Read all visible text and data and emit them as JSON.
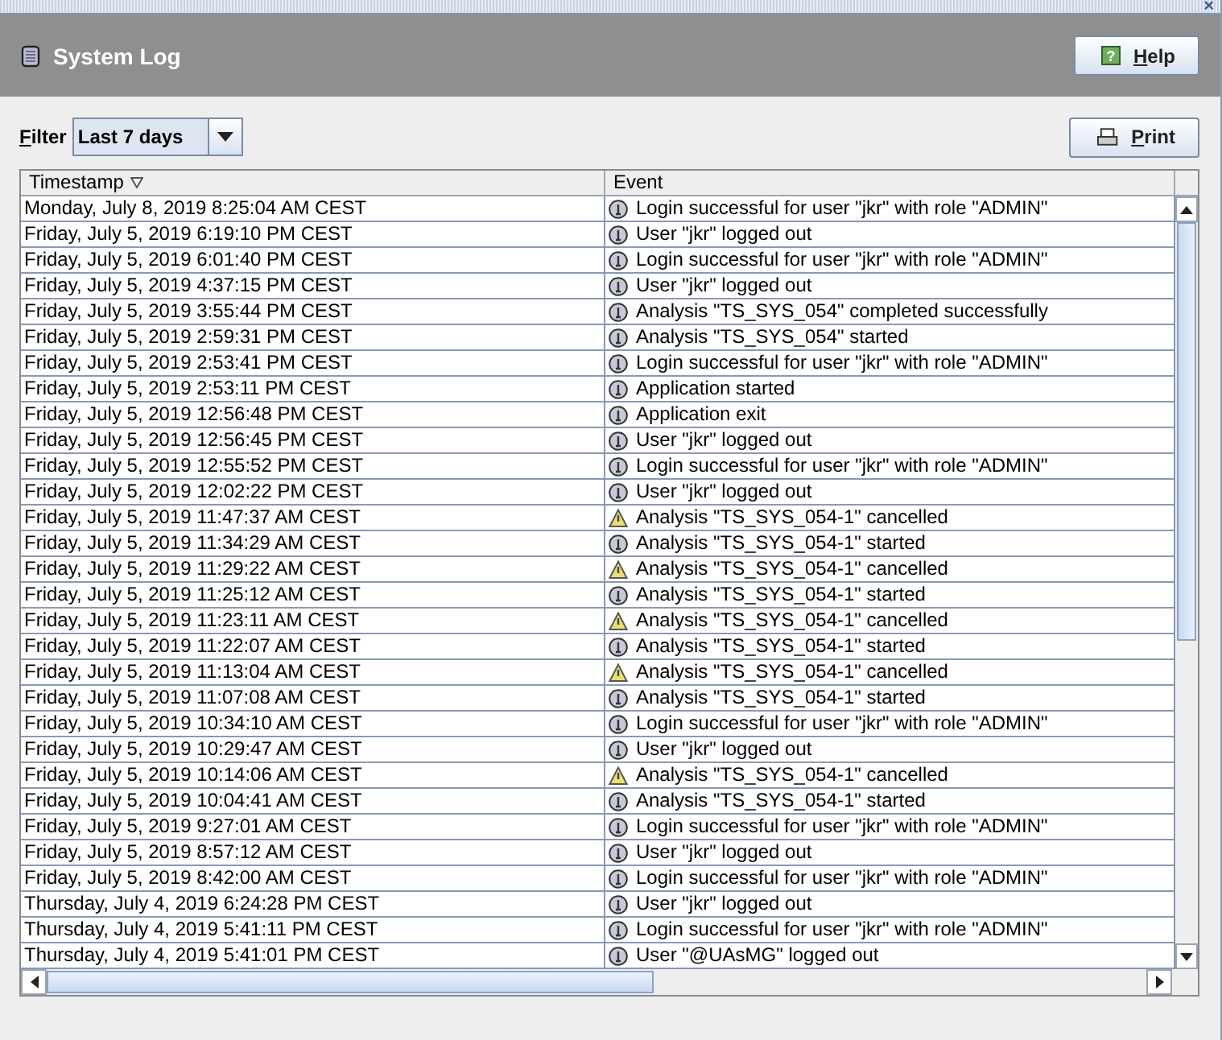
{
  "window": {
    "title": "System Log",
    "close": "×"
  },
  "header": {
    "help_button": "Help",
    "help_icon": "?"
  },
  "filter": {
    "label": "Filter",
    "value": "Last 7 days"
  },
  "print_button": "Print",
  "table": {
    "columns": [
      {
        "label": "Timestamp",
        "sorted": true
      },
      {
        "label": "Event",
        "sorted": false
      }
    ],
    "rows": [
      {
        "timestamp": "Monday, July 8, 2019 8:25:04 AM CEST",
        "kind": "info",
        "event": "Login successful for user \"jkr\" with role \"ADMIN\""
      },
      {
        "timestamp": "Friday, July 5, 2019 6:19:10 PM CEST",
        "kind": "info",
        "event": "User \"jkr\" logged out"
      },
      {
        "timestamp": "Friday, July 5, 2019 6:01:40 PM CEST",
        "kind": "info",
        "event": "Login successful for user \"jkr\" with role \"ADMIN\""
      },
      {
        "timestamp": "Friday, July 5, 2019 4:37:15 PM CEST",
        "kind": "info",
        "event": "User \"jkr\" logged out"
      },
      {
        "timestamp": "Friday, July 5, 2019 3:55:44 PM CEST",
        "kind": "info",
        "event": "Analysis \"TS_SYS_054\" completed successfully"
      },
      {
        "timestamp": "Friday, July 5, 2019 2:59:31 PM CEST",
        "kind": "info",
        "event": "Analysis \"TS_SYS_054\" started"
      },
      {
        "timestamp": "Friday, July 5, 2019 2:53:41 PM CEST",
        "kind": "info",
        "event": "Login successful for user \"jkr\" with role \"ADMIN\""
      },
      {
        "timestamp": "Friday, July 5, 2019 2:53:11 PM CEST",
        "kind": "info",
        "event": "Application started"
      },
      {
        "timestamp": "Friday, July 5, 2019 12:56:48 PM CEST",
        "kind": "info",
        "event": "Application exit"
      },
      {
        "timestamp": "Friday, July 5, 2019 12:56:45 PM CEST",
        "kind": "info",
        "event": "User \"jkr\" logged out"
      },
      {
        "timestamp": "Friday, July 5, 2019 12:55:52 PM CEST",
        "kind": "info",
        "event": "Login successful for user \"jkr\" with role \"ADMIN\""
      },
      {
        "timestamp": "Friday, July 5, 2019 12:02:22 PM CEST",
        "kind": "info",
        "event": "User \"jkr\" logged out"
      },
      {
        "timestamp": "Friday, July 5, 2019 11:47:37 AM CEST",
        "kind": "warning",
        "event": "Analysis \"TS_SYS_054-1\" cancelled"
      },
      {
        "timestamp": "Friday, July 5, 2019 11:34:29 AM CEST",
        "kind": "info",
        "event": "Analysis \"TS_SYS_054-1\" started"
      },
      {
        "timestamp": "Friday, July 5, 2019 11:29:22 AM CEST",
        "kind": "warning",
        "event": "Analysis \"TS_SYS_054-1\" cancelled"
      },
      {
        "timestamp": "Friday, July 5, 2019 11:25:12 AM CEST",
        "kind": "info",
        "event": "Analysis \"TS_SYS_054-1\" started"
      },
      {
        "timestamp": "Friday, July 5, 2019 11:23:11 AM CEST",
        "kind": "warning",
        "event": "Analysis \"TS_SYS_054-1\" cancelled"
      },
      {
        "timestamp": "Friday, July 5, 2019 11:22:07 AM CEST",
        "kind": "info",
        "event": "Analysis \"TS_SYS_054-1\" started"
      },
      {
        "timestamp": "Friday, July 5, 2019 11:13:04 AM CEST",
        "kind": "warning",
        "event": "Analysis \"TS_SYS_054-1\" cancelled"
      },
      {
        "timestamp": "Friday, July 5, 2019 11:07:08 AM CEST",
        "kind": "info",
        "event": "Analysis \"TS_SYS_054-1\" started"
      },
      {
        "timestamp": "Friday, July 5, 2019 10:34:10 AM CEST",
        "kind": "info",
        "event": "Login successful for user \"jkr\" with role \"ADMIN\""
      },
      {
        "timestamp": "Friday, July 5, 2019 10:29:47 AM CEST",
        "kind": "info",
        "event": "User \"jkr\" logged out"
      },
      {
        "timestamp": "Friday, July 5, 2019 10:14:06 AM CEST",
        "kind": "warning",
        "event": "Analysis \"TS_SYS_054-1\" cancelled"
      },
      {
        "timestamp": "Friday, July 5, 2019 10:04:41 AM CEST",
        "kind": "info",
        "event": "Analysis \"TS_SYS_054-1\" started"
      },
      {
        "timestamp": "Friday, July 5, 2019 9:27:01 AM CEST",
        "kind": "info",
        "event": "Login successful for user \"jkr\" with role \"ADMIN\""
      },
      {
        "timestamp": "Friday, July 5, 2019 8:57:12 AM CEST",
        "kind": "info",
        "event": "User \"jkr\" logged out"
      },
      {
        "timestamp": "Friday, July 5, 2019 8:42:00 AM CEST",
        "kind": "info",
        "event": "Login successful for user \"jkr\" with role \"ADMIN\""
      },
      {
        "timestamp": "Thursday, July 4, 2019 6:24:28 PM CEST",
        "kind": "info",
        "event": "User \"jkr\" logged out"
      },
      {
        "timestamp": "Thursday, July 4, 2019 5:41:11 PM CEST",
        "kind": "info",
        "event": "Login successful for user \"jkr\" with role \"ADMIN\""
      },
      {
        "timestamp": "Thursday, July 4, 2019 5:41:01 PM CEST",
        "kind": "info",
        "event": "User \"@UAsMG\" logged out"
      }
    ]
  }
}
